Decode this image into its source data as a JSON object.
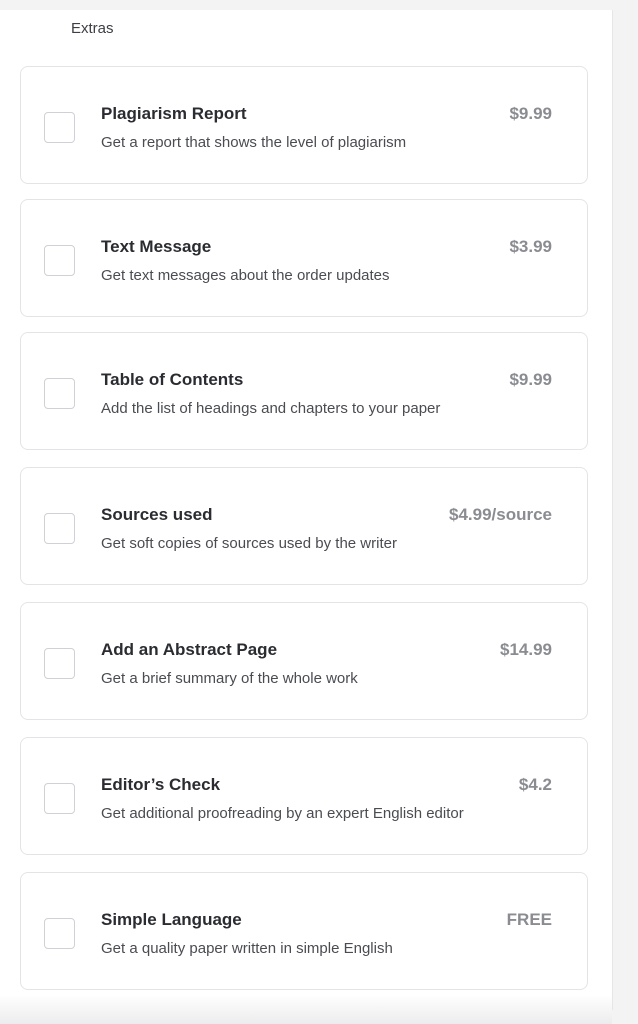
{
  "section": {
    "title": "Extras"
  },
  "extras": [
    {
      "title": "Plagiarism Report",
      "description": "Get a report that shows the level of plagiarism",
      "price": "$9.99",
      "checked": false
    },
    {
      "title": "Text Message",
      "description": "Get text messages about the order updates",
      "price": "$3.99",
      "checked": false
    },
    {
      "title": "Table of Contents",
      "description": "Add the list of headings and chapters to your paper",
      "price": "$9.99",
      "checked": false
    },
    {
      "title": "Sources used",
      "description": "Get soft copies of sources used by the writer",
      "price": "$4.99/source",
      "checked": false
    },
    {
      "title": "Add an Abstract Page",
      "description": "Get a brief summary of the whole work",
      "price": "$14.99",
      "checked": false
    },
    {
      "title": "Editor’s Check",
      "description": "Get additional proofreading by an expert English editor",
      "price": "$4.2",
      "checked": false
    },
    {
      "title": "Simple Language",
      "description": "Get a quality paper written in simple English",
      "price": "FREE",
      "checked": false
    }
  ],
  "colors": {
    "title_text": "#2a2c31",
    "price_text": "#8a8c91",
    "card_border": "#e3e4e8"
  }
}
